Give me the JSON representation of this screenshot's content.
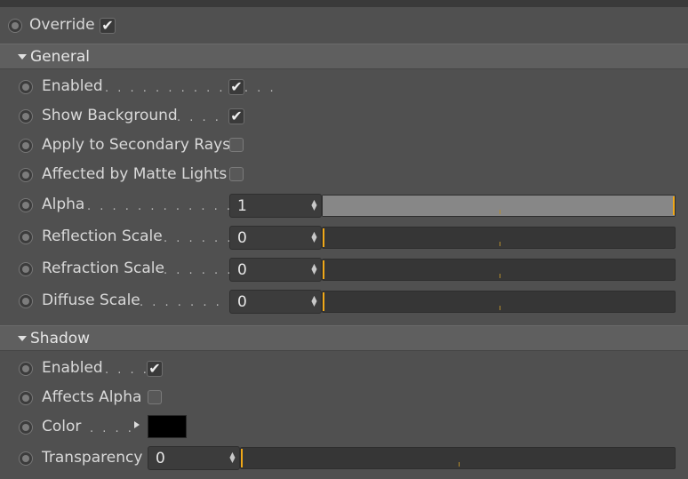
{
  "override": {
    "label": "Override",
    "checked": true
  },
  "general": {
    "title": "General",
    "enabled": {
      "label": "Enabled",
      "dots": ". . . . . . . . . . . . . .",
      "checked": true
    },
    "show_background": {
      "label": "Show Background",
      "dots": ". . . . .",
      "checked": true
    },
    "secondary_rays": {
      "label": "Apply to Secondary Rays",
      "checked": false
    },
    "matte_lights": {
      "label": "Affected by Matte Lights",
      "checked": false
    },
    "alpha": {
      "label": "Alpha",
      "dots": ". . . . . . . . . . . . . . . .",
      "value": "1",
      "fraction": 1.0
    },
    "reflection_scale": {
      "label": "Reflection Scale",
      "dots": ". . . . . . .",
      "value": "0",
      "fraction": 0.0
    },
    "refraction_scale": {
      "label": "Refraction Scale",
      "dots": ". . . . . . .",
      "value": "0",
      "fraction": 0.0
    },
    "diffuse_scale": {
      "label": "Diffuse Scale",
      "dots": ". . . . . . . . . .",
      "value": "0",
      "fraction": 0.0
    }
  },
  "shadow": {
    "title": "Shadow",
    "enabled": {
      "label": "Enabled",
      "dots": ". . . . .",
      "checked": true
    },
    "affects_alpha": {
      "label": "Affects Alpha",
      "checked": false
    },
    "color": {
      "label": "Color",
      "dots": ". . . .",
      "swatch": "#000000"
    },
    "transparency": {
      "label": "Transparency",
      "value": "0",
      "fraction": 0.0
    }
  },
  "colors": {
    "accent": "#f0a818",
    "panel": "#505050",
    "header": "#5f5f5f"
  },
  "check_glyph": "✔"
}
